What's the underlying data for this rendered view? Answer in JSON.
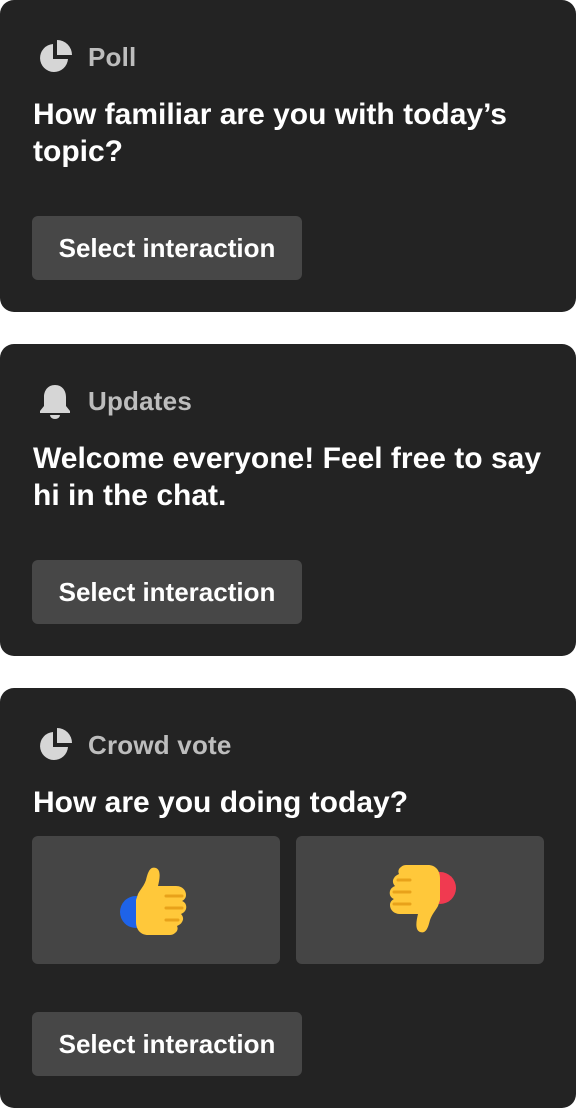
{
  "cards": [
    {
      "header_label": "Poll",
      "icon": "pie-chart-icon",
      "question": "How familiar are you with today’s topic?",
      "button_label": "Select interaction"
    },
    {
      "header_label": "Updates",
      "icon": "bell-icon",
      "question": "Welcome everyone! Feel free to say hi in the chat.",
      "button_label": "Select interaction"
    },
    {
      "header_label": "Crowd vote",
      "icon": "pie-chart-icon",
      "question": "How are you doing today?",
      "options": [
        "thumbs-up-icon",
        "thumbs-down-icon"
      ],
      "button_label": "Select interaction"
    }
  ],
  "colors": {
    "page_background": "#ffffff",
    "card_background": "#232323",
    "button_background": "#474747",
    "header_text": "#bdbdbd",
    "thumb_yellow": "#FFC83A",
    "thumb_up_accent": "#1E63E9",
    "thumb_down_accent": "#F03A50"
  }
}
